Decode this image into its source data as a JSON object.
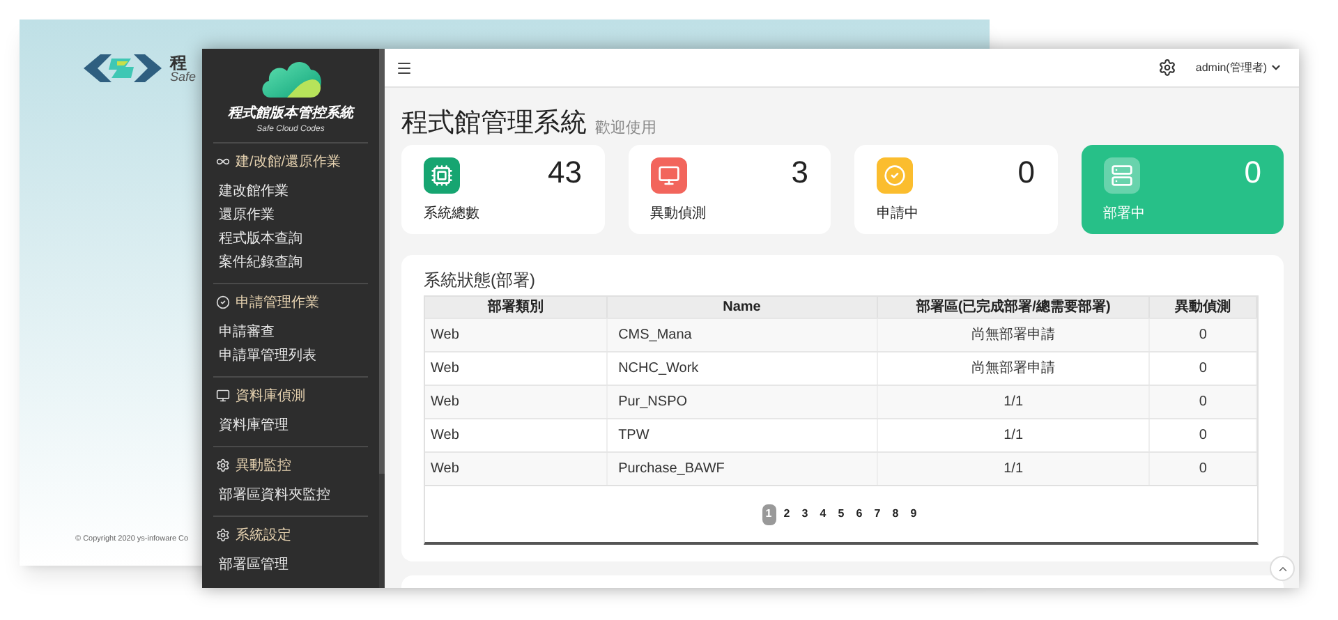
{
  "back_window": {
    "logo_title": "程",
    "logo_subtitle": "Safe",
    "copyright": "© Copyright 2020 ys-infoware Co"
  },
  "sidebar": {
    "brand_title": "程式館版本管控系統",
    "brand_subtitle": "Safe Cloud Codes",
    "sections": [
      {
        "title": "建/改館/還原作業",
        "items": [
          "建改館作業",
          "還原作業",
          "程式版本查詢",
          "案件紀錄查詢"
        ]
      },
      {
        "title": "申請管理作業",
        "items": [
          "申請審查",
          "申請單管理列表"
        ]
      },
      {
        "title": "資料庫偵測",
        "items": [
          "資料庫管理"
        ]
      },
      {
        "title": "異動監控",
        "items": [
          "部署區資料夾監控"
        ]
      },
      {
        "title": "系統設定",
        "items": [
          "部署區管理"
        ]
      }
    ]
  },
  "header": {
    "user": "admin(管理者)"
  },
  "page": {
    "title": "程式館管理系統",
    "subtitle": "歡迎使用"
  },
  "cards": [
    {
      "value": "43",
      "label": "系統總數",
      "color": "#16a571",
      "active": false
    },
    {
      "value": "3",
      "label": "異動偵測",
      "color": "#f2655c",
      "active": false
    },
    {
      "value": "0",
      "label": "申請中",
      "color": "#fbbd2e",
      "active": false
    },
    {
      "value": "0",
      "label": "部署中",
      "color": "#27c088",
      "active": true
    }
  ],
  "table": {
    "title": "系統狀態(部署)",
    "columns": [
      "部署類別",
      "Name",
      "部署區(已完成部署/總需要部署)",
      "異動偵測"
    ],
    "rows": [
      [
        "Web",
        "CMS_Mana",
        "尚無部署申請",
        "0"
      ],
      [
        "Web",
        "NCHC_Work",
        "尚無部署申請",
        "0"
      ],
      [
        "Web",
        "Pur_NSPO",
        "1/1",
        "0"
      ],
      [
        "Web",
        "TPW",
        "1/1",
        "0"
      ],
      [
        "Web",
        "Purchase_BAWF",
        "1/1",
        "0"
      ]
    ],
    "pages": [
      {
        "label": "1",
        "selected": true
      },
      {
        "label": "2",
        "selected": false
      },
      {
        "label": "3",
        "selected": false
      },
      {
        "label": "4",
        "selected": false
      },
      {
        "label": "5",
        "selected": false
      },
      {
        "label": "6",
        "selected": false
      },
      {
        "label": "7",
        "selected": false
      },
      {
        "label": "8",
        "selected": false
      },
      {
        "label": "9",
        "selected": false
      }
    ]
  }
}
